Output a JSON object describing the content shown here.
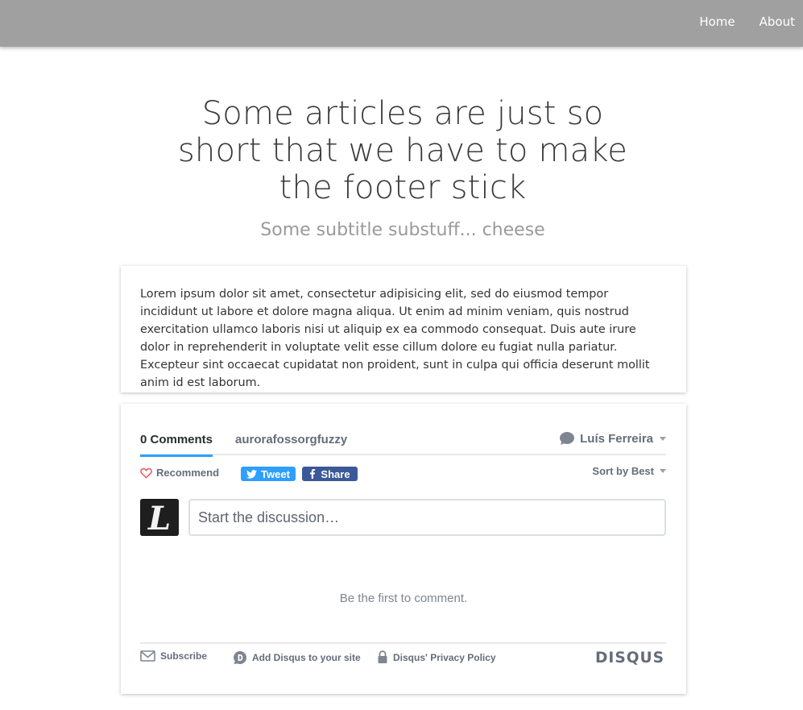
{
  "nav": {
    "items": [
      {
        "label": "Home"
      },
      {
        "label": "About"
      }
    ]
  },
  "header": {
    "title": "Some articles are just so short that we have to make the footer stick",
    "subtitle": "Some subtitle substuff... cheese"
  },
  "article": {
    "body": "Lorem ipsum dolor sit amet, consectetur adipisicing elit, sed do eiusmod tempor incididunt ut labore et dolore magna aliqua. Ut enim ad minim veniam, quis nostrud exercitation ullamco laboris nisi ut aliquip ex ea commodo consequat. Duis aute irure dolor in reprehenderit in voluptate velit esse cillum dolore eu fugiat nulla pariatur. Excepteur sint occaecat cupidatat non proident, sunt in culpa qui officia deserunt mollit anim id est laborum."
  },
  "disqus": {
    "comment_count_label": "0 Comments",
    "forum_name": "aurorafossorgfuzzy",
    "user_name": "Luís Ferreira",
    "recommend_label": "Recommend",
    "tweet_label": "Tweet",
    "share_label": "Share",
    "sort_label": "Sort by Best",
    "composer_placeholder": "Start the discussion…",
    "avatar_letter": "L",
    "empty_message": "Be the first to comment.",
    "footer": {
      "subscribe_label": "Subscribe",
      "add_label": "Add Disqus to your site",
      "privacy_label": "Disqus' Privacy Policy",
      "logo_text": "DISQUS"
    },
    "colors": {
      "accent": "#2e9fff",
      "facebook": "#3b5998",
      "heart": "#e7565e",
      "text_muted": "#656c7a"
    }
  }
}
